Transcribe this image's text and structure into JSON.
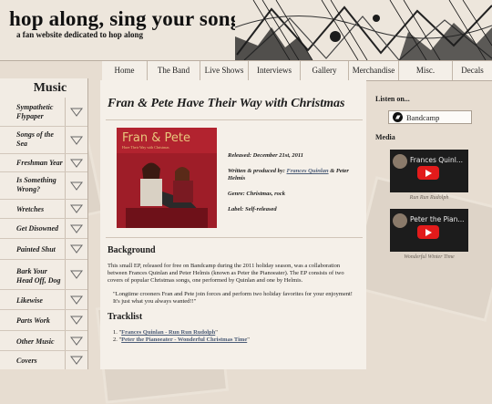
{
  "header": {
    "title": "hop along, sing your song",
    "tagline": "a fan website dedicated to hop along"
  },
  "nav": [
    {
      "label": "Home"
    },
    {
      "label": "The Band"
    },
    {
      "label": "Live Shows"
    },
    {
      "label": "Interviews"
    },
    {
      "label": "Gallery"
    },
    {
      "label": "Merchandise"
    },
    {
      "label": "Misc."
    },
    {
      "label": "Decals"
    }
  ],
  "sidebar": {
    "title": "Music",
    "items": [
      {
        "label": "Sympathetic Flypaper"
      },
      {
        "label": "Songs of the Sea"
      },
      {
        "label": "Freshman Year"
      },
      {
        "label": "Is Something Wrong?"
      },
      {
        "label": "Wretches"
      },
      {
        "label": "Get Disowned"
      },
      {
        "label": "Painted Shut"
      },
      {
        "label": "Bark Your Head Off, Dog"
      },
      {
        "label": "Likewise"
      },
      {
        "label": "Parts Work"
      },
      {
        "label": "Other Music"
      },
      {
        "label": "Covers"
      }
    ]
  },
  "main": {
    "title": "Fran & Pete Have Their Way with Christmas",
    "cover": {
      "title": "Fran & Pete",
      "subtitle": "Have Their Way with Christmas"
    },
    "details": {
      "released": "Released: December 21st, 2011",
      "written_prefix": "Written & produced by: ",
      "written_link": "Frances Quinlan",
      "written_suffix": " & Peter Helmis",
      "genre": "Genre: Christmas, rock",
      "label": "Label: Self-released"
    },
    "background_heading": "Background",
    "background_text": "This small EP, released for free on Bandcamp during the 2011 holiday season, was a collaboration between Frances Quinlan and Peter Helmis (known as Peter the Pianoeater). The EP consists of two covers of popular Christmas songs, one performed by Quinlan and one by Helmis.",
    "quote": "\"Longtime crooners Fran and Pete join forces and perform two holiday favorites for your enjoyment! It's just what you always wanted!!\"",
    "tracklist_heading": "Tracklist",
    "tracks": [
      {
        "num": "1. \"",
        "title": "Frances Quinlan - Run Run Rudolph",
        "end": "\""
      },
      {
        "num": "2. \"",
        "title": "Peter the Pianoeater - Wonderful Christmas Time",
        "end": "\""
      }
    ]
  },
  "right": {
    "listen_heading": "Listen on...",
    "bandcamp_label": "Bandcamp",
    "media_heading": "Media",
    "videos": [
      {
        "title": "Frances Quinl...",
        "caption": "Run Run Rudolph"
      },
      {
        "title": "Peter the Pian...",
        "caption": "Wonderful Winter Time"
      }
    ]
  },
  "colors": {
    "accent_red": "#b2232f",
    "link_blue": "#4b5c77",
    "youtube_red": "#e21b1b"
  }
}
